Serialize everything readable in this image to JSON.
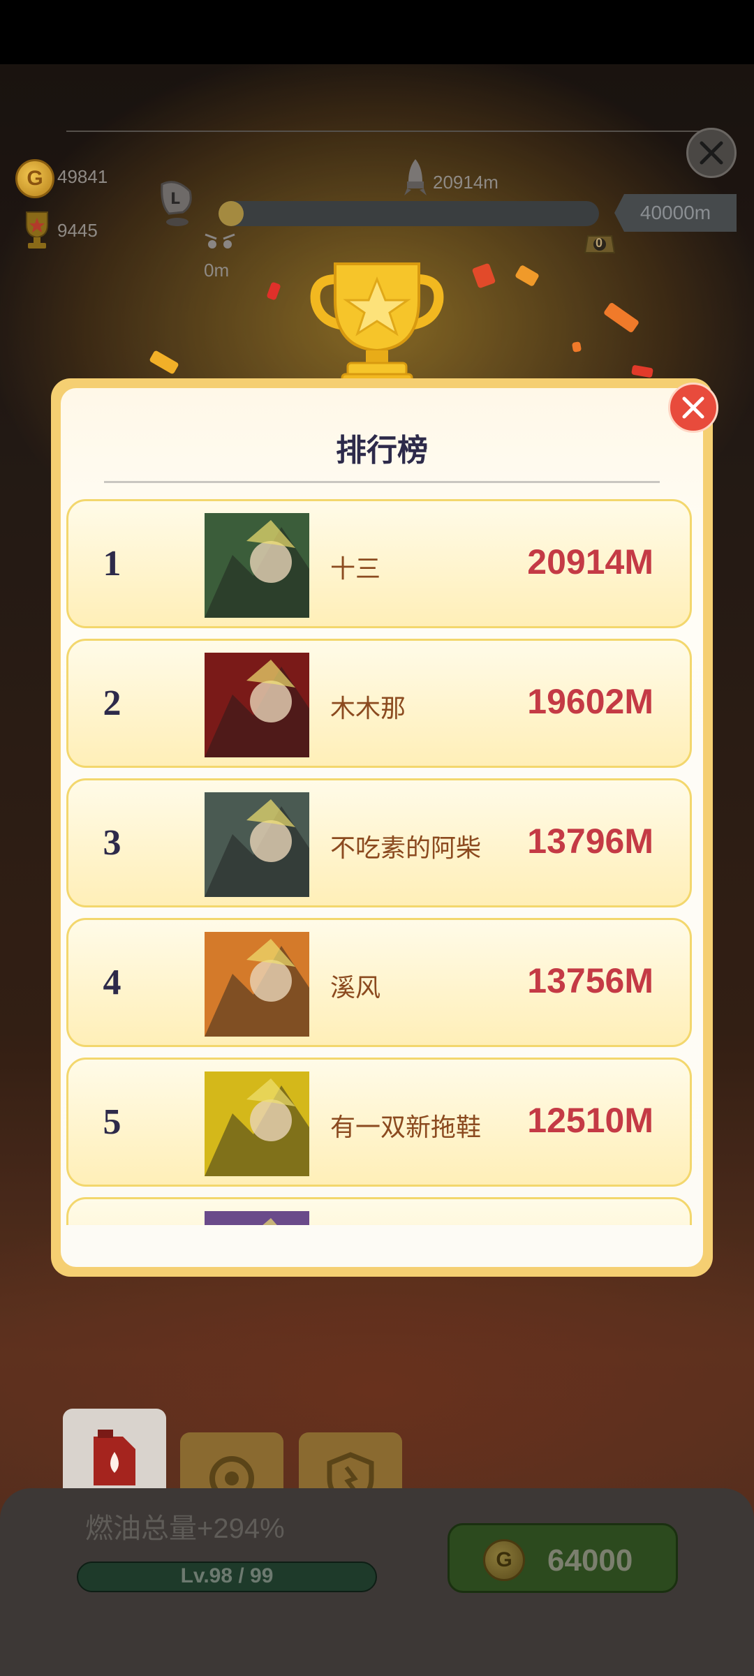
{
  "top_hud": {
    "coins": "49841",
    "trophies": "9445",
    "current_distance": "20914m",
    "start_distance": "0m",
    "goal_distance": "40000m",
    "progress_fraction": 0.05,
    "badge_count": "0"
  },
  "leaderboard": {
    "title": "排行榜",
    "rows": [
      {
        "rank": "1",
        "name": "十三",
        "distance": "20914M",
        "avatar_color": "#3b5d3a"
      },
      {
        "rank": "2",
        "name": "木木那",
        "distance": "19602M",
        "avatar_color": "#7a1a18"
      },
      {
        "rank": "3",
        "name": "不吃素的阿柴",
        "distance": "13796M",
        "avatar_color": "#4a5a52"
      },
      {
        "rank": "4",
        "name": "溪风",
        "distance": "13756M",
        "avatar_color": "#d47a2a"
      },
      {
        "rank": "5",
        "name": "有一双新拖鞋",
        "distance": "12510M",
        "avatar_color": "#d4b81a"
      },
      {
        "rank": "",
        "name": "",
        "distance": "",
        "avatar_color": "#6a4a8a"
      }
    ]
  },
  "upgrade": {
    "label": "燃油总量+294%",
    "level": "Lv.98 / 99",
    "cost": "64000"
  },
  "colors": {
    "panel_border": "#f5cf72",
    "distance_text": "#c43a45",
    "name_text": "#8b4a1f",
    "close_red": "#e84b3c"
  }
}
